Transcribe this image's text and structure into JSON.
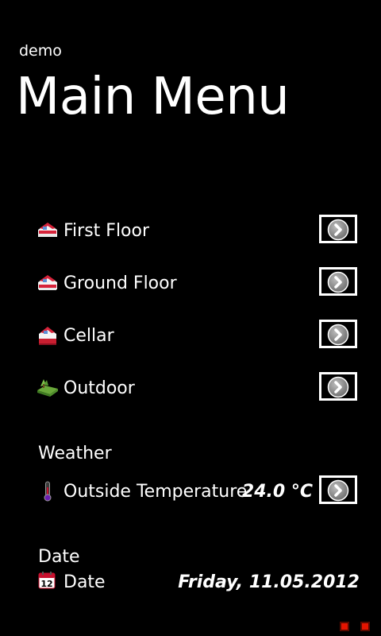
{
  "app": {
    "name": "demo",
    "title": "Main Menu"
  },
  "menu": {
    "items": [
      {
        "label": "First Floor",
        "icon": "house-floor-icon"
      },
      {
        "label": "Ground Floor",
        "icon": "house-floor-icon"
      },
      {
        "label": "Cellar",
        "icon": "house-cellar-icon"
      },
      {
        "label": "Outdoor",
        "icon": "outdoor-icon"
      }
    ]
  },
  "weather": {
    "header": "Weather",
    "outside_temperature": {
      "label": "Outside Temperature",
      "value": "24.0 °C",
      "icon": "thermometer-icon"
    }
  },
  "date": {
    "header": "Date",
    "label": "Date",
    "value": "Friday, 11.05.2012",
    "icon": "calendar-icon",
    "icon_number": "12"
  },
  "colors": {
    "background": "#000000",
    "text": "#ffffff",
    "accent_red": "#e51400",
    "house_roof": "#d6233a",
    "house_wall": "#f4f4f4",
    "house_window": "#5b8fd6",
    "outdoor_green": "#6aa83a"
  }
}
